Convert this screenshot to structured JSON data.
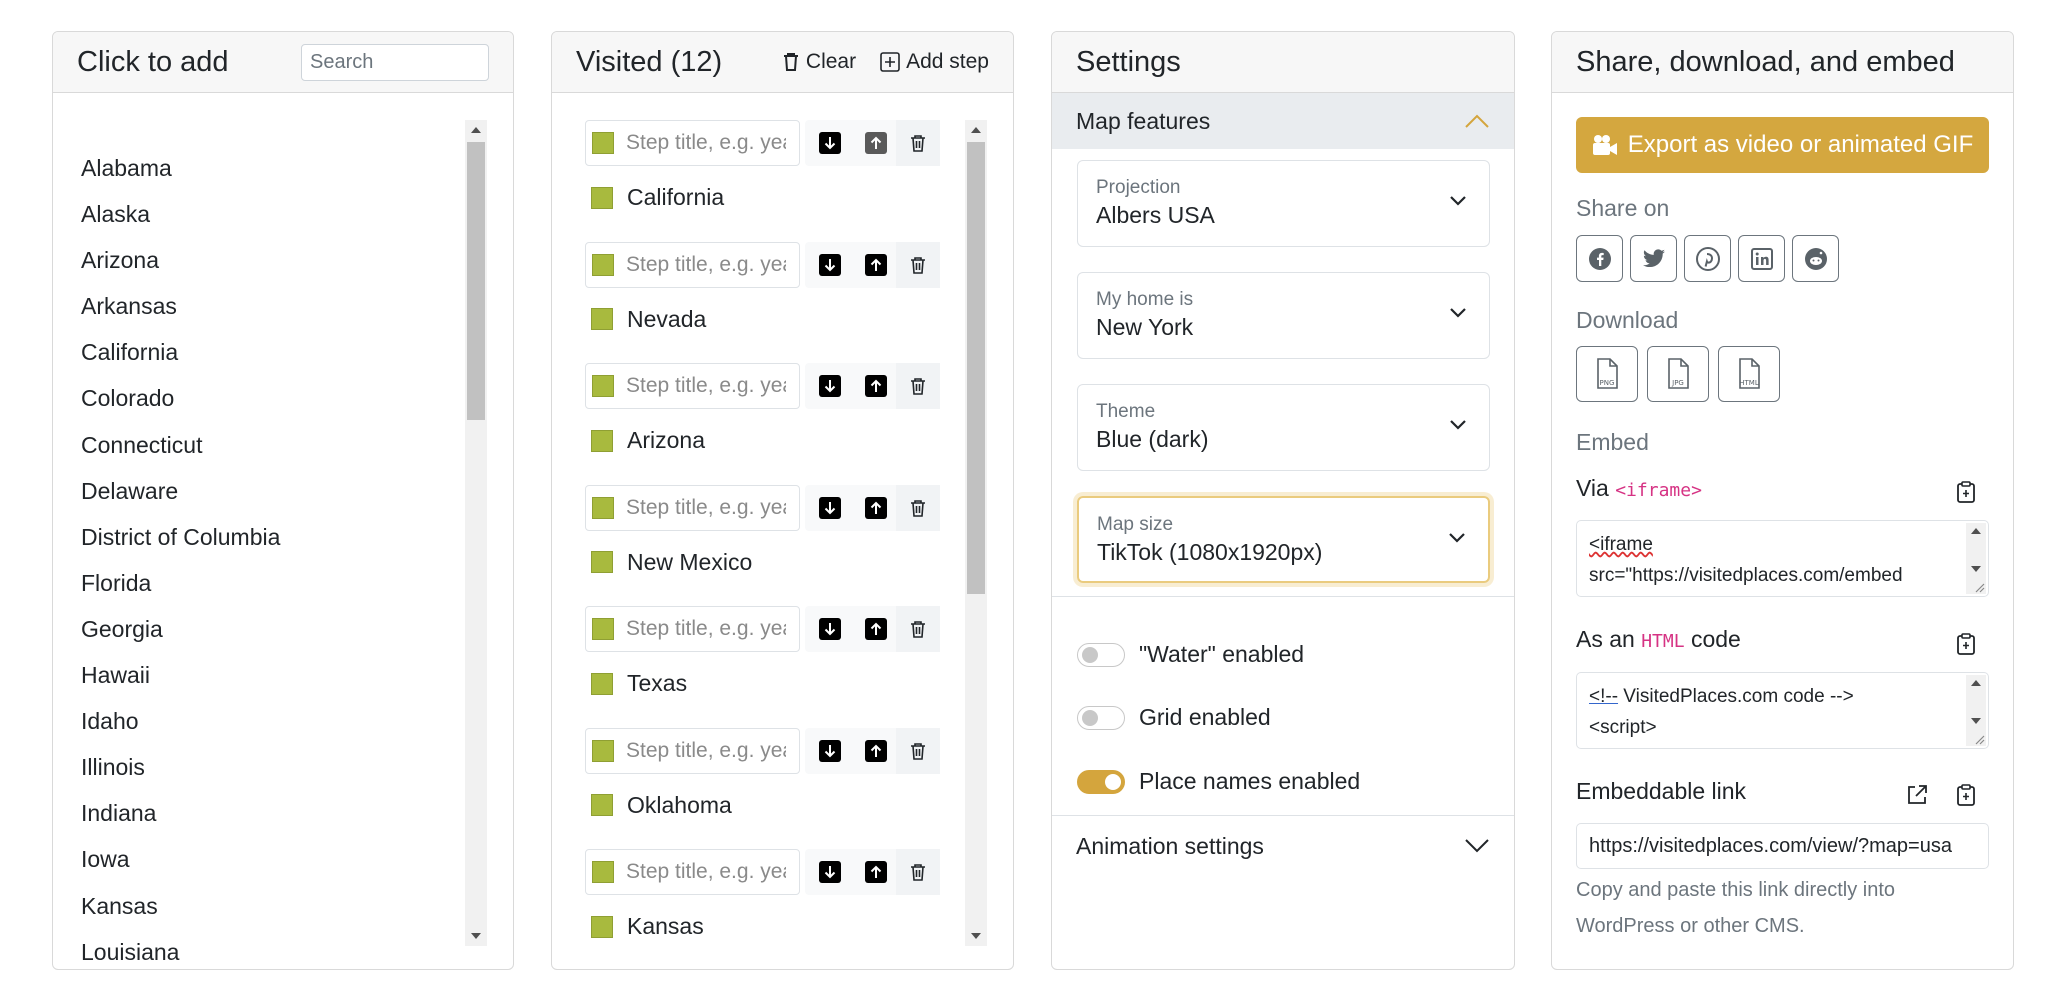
{
  "click_to_add": {
    "title": "Click to add",
    "search_placeholder": "Search",
    "states": [
      "Alabama",
      "Alaska",
      "Arizona",
      "Arkansas",
      "California",
      "Colorado",
      "Connecticut",
      "Delaware",
      "District of Columbia",
      "Florida",
      "Georgia",
      "Hawaii",
      "Idaho",
      "Illinois",
      "Indiana",
      "Iowa",
      "Kansas",
      "Louisiana"
    ]
  },
  "visited": {
    "title": "Visited (12)",
    "clear_label": "Clear",
    "add_step_label": "Add step",
    "step_placeholder": "Step title, e.g. year",
    "steps": [
      {
        "place": "California",
        "up_disabled": true
      },
      {
        "place": "Nevada",
        "up_disabled": false
      },
      {
        "place": "Arizona",
        "up_disabled": false
      },
      {
        "place": "New Mexico",
        "up_disabled": false
      },
      {
        "place": "Texas",
        "up_disabled": false
      },
      {
        "place": "Oklahoma",
        "up_disabled": false
      },
      {
        "place": "Kansas",
        "up_disabled": false
      }
    ],
    "swatch_color": "#a8ba3e"
  },
  "settings": {
    "title": "Settings",
    "map_features_label": "Map features",
    "projection": {
      "label": "Projection",
      "value": "Albers USA"
    },
    "home": {
      "label": "My home is",
      "value": "New York"
    },
    "theme": {
      "label": "Theme",
      "value": "Blue (dark)"
    },
    "map_size": {
      "label": "Map size",
      "value": "TikTok (1080x1920px)"
    },
    "water_label": "\"Water\" enabled",
    "water_on": false,
    "grid_label": "Grid enabled",
    "grid_on": false,
    "place_names_label": "Place names enabled",
    "place_names_on": true,
    "animation_label": "Animation settings"
  },
  "share": {
    "title": "Share, download, and embed",
    "export_label": "Export as video or animated GIF",
    "share_on_label": "Share on",
    "share_icons": [
      "facebook-icon",
      "twitter-icon",
      "pinterest-icon",
      "linkedin-icon",
      "reddit-icon"
    ],
    "download_label": "Download",
    "download_formats": [
      "PNG",
      "JPG",
      "HTML"
    ],
    "embed_label": "Embed",
    "via_label": "Via",
    "iframe_chip": "<iframe>",
    "iframe_line1": "<iframe",
    "iframe_line2": "src=\"https://visitedplaces.com/embed",
    "html_code_prefix": "As an",
    "html_chip": "HTML",
    "html_code_suffix": "code",
    "html_line1_tag": "<!--",
    "html_line1_rest": " VisitedPlaces.com code -->",
    "html_line2": "<script>",
    "embeddable_link_label": "Embeddable link",
    "embeddable_link_value": "https://visitedplaces.com/view/?map=usa",
    "helper_text": "Copy and paste this link directly into WordPress or other CMS.",
    "accent_color": "#d4a73f"
  }
}
